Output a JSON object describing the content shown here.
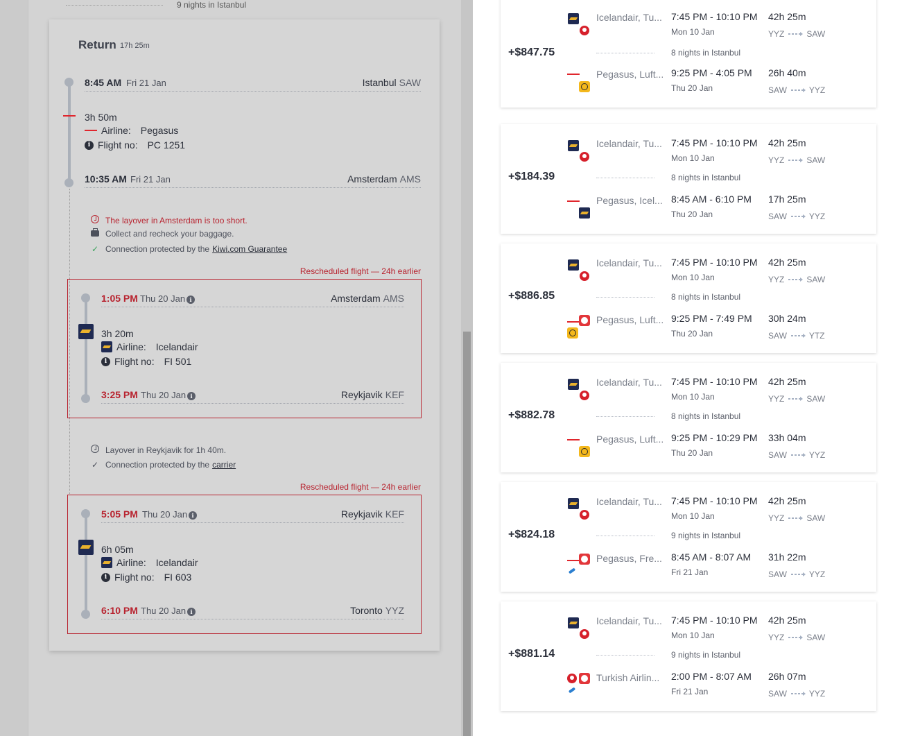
{
  "top_remnant": "9 nights in Istanbul",
  "return_section": {
    "title": "Return",
    "duration": "17h 25m",
    "stops": [
      {
        "time": "8:45 AM",
        "date": "Fri 21 Jan",
        "city": "Istanbul",
        "code": "SAW"
      },
      {
        "time": "10:35 AM",
        "date": "Fri 21 Jan",
        "city": "Amsterdam",
        "code": "AMS"
      }
    ],
    "segment1": {
      "duration": "3h 50m",
      "airline_label": "Airline:",
      "airline": "Pegasus",
      "flight_label": "Flight no:",
      "flight": "PC 1251"
    },
    "layover1": {
      "warning": "The layover in Amsterdam is too short.",
      "baggage": "Collect and recheck your baggage.",
      "protected_prefix": "Connection protected by the",
      "protected_link": "Kiwi.com Guarantee"
    },
    "resched1": {
      "label": "Rescheduled flight — 24h earlier",
      "dep": {
        "time": "1:05 PM",
        "date": "Thu 20 Jan",
        "city": "Amsterdam",
        "code": "AMS"
      },
      "arr": {
        "time": "3:25 PM",
        "date": "Thu 20 Jan",
        "city": "Reykjavik",
        "code": "KEF"
      },
      "duration": "3h 20m",
      "airline_label": "Airline:",
      "airline": "Icelandair",
      "flight_label": "Flight no:",
      "flight": "FI 501"
    },
    "layover2": {
      "info": "Layover in Reykjavik for 1h 40m.",
      "protected_prefix": "Connection protected by the",
      "protected_link": "carrier"
    },
    "resched2": {
      "label": "Rescheduled flight — 24h earlier",
      "dep": {
        "time": "5:05 PM",
        "date": "Thu 20 Jan",
        "city": "Reykjavik",
        "code": "KEF"
      },
      "arr": {
        "time": "6:10 PM",
        "date": "Thu 20 Jan",
        "city": "Toronto",
        "code": "YYZ"
      },
      "duration": "6h 05m",
      "airline_label": "Airline:",
      "airline": "Icelandair",
      "flight_label": "Flight no:",
      "flight": "FI 603"
    }
  },
  "results": [
    {
      "price": "+$847.75",
      "out": {
        "airline": "Icelandair, Tu...",
        "times": "7:45 PM - 10:10 PM",
        "date": "Mon 10 Jan",
        "duration": "42h 25m",
        "from": "YYZ",
        "to": "SAW"
      },
      "nights": "8 nights in Istanbul",
      "ret": {
        "airline": "Pegasus, Luft...",
        "times": "9:25 PM - 4:05 PM",
        "date": "Thu 20 Jan",
        "duration": "26h 40m",
        "from": "SAW",
        "to": "YYZ"
      }
    },
    {
      "price": "+$184.39",
      "out": {
        "airline": "Icelandair, Tu...",
        "times": "7:45 PM - 10:10 PM",
        "date": "Mon 10 Jan",
        "duration": "42h 25m",
        "from": "YYZ",
        "to": "SAW"
      },
      "nights": "8 nights in Istanbul",
      "ret": {
        "airline": "Pegasus, Icel...",
        "times": "8:45 AM - 6:10 PM",
        "date": "Thu 20 Jan",
        "duration": "17h 25m",
        "from": "SAW",
        "to": "YYZ"
      }
    },
    {
      "price": "+$886.85",
      "out": {
        "airline": "Icelandair, Tu...",
        "times": "7:45 PM - 10:10 PM",
        "date": "Mon 10 Jan",
        "duration": "42h 25m",
        "from": "YYZ",
        "to": "SAW"
      },
      "nights": "8 nights in Istanbul",
      "ret": {
        "airline": "Pegasus, Luft...",
        "times": "9:25 PM - 7:49 PM",
        "date": "Thu 20 Jan",
        "duration": "30h 24m",
        "from": "SAW",
        "to": "YTZ"
      }
    },
    {
      "price": "+$882.78",
      "out": {
        "airline": "Icelandair, Tu...",
        "times": "7:45 PM - 10:10 PM",
        "date": "Mon 10 Jan",
        "duration": "42h 25m",
        "from": "YYZ",
        "to": "SAW"
      },
      "nights": "8 nights in Istanbul",
      "ret": {
        "airline": "Pegasus, Luft...",
        "times": "9:25 PM - 10:29 PM",
        "date": "Thu 20 Jan",
        "duration": "33h 04m",
        "from": "SAW",
        "to": "YYZ"
      }
    },
    {
      "price": "+$824.18",
      "out": {
        "airline": "Icelandair, Tu...",
        "times": "7:45 PM - 10:10 PM",
        "date": "Mon 10 Jan",
        "duration": "42h 25m",
        "from": "YYZ",
        "to": "SAW"
      },
      "nights": "9 nights in Istanbul",
      "ret": {
        "airline": "Pegasus, Fre...",
        "times": "8:45 AM - 8:07 AM",
        "date": "Fri 21 Jan",
        "duration": "31h 22m",
        "from": "SAW",
        "to": "YYZ"
      }
    },
    {
      "price": "+$881.14",
      "out": {
        "airline": "Icelandair, Tu...",
        "times": "7:45 PM - 10:10 PM",
        "date": "Mon 10 Jan",
        "duration": "42h 25m",
        "from": "YYZ",
        "to": "SAW"
      },
      "nights": "9 nights in Istanbul",
      "ret": {
        "airline": "Turkish Airlin...",
        "times": "2:00 PM - 8:07 AM",
        "date": "Fri 21 Jan",
        "duration": "26h 07m",
        "from": "SAW",
        "to": "YYZ"
      }
    }
  ],
  "colors": {
    "warning_red": "#b8232f",
    "timeline_gray": "#aab0b9",
    "icelandair_navy": "#1f2a52",
    "icelandair_gold": "#e9b12d"
  }
}
